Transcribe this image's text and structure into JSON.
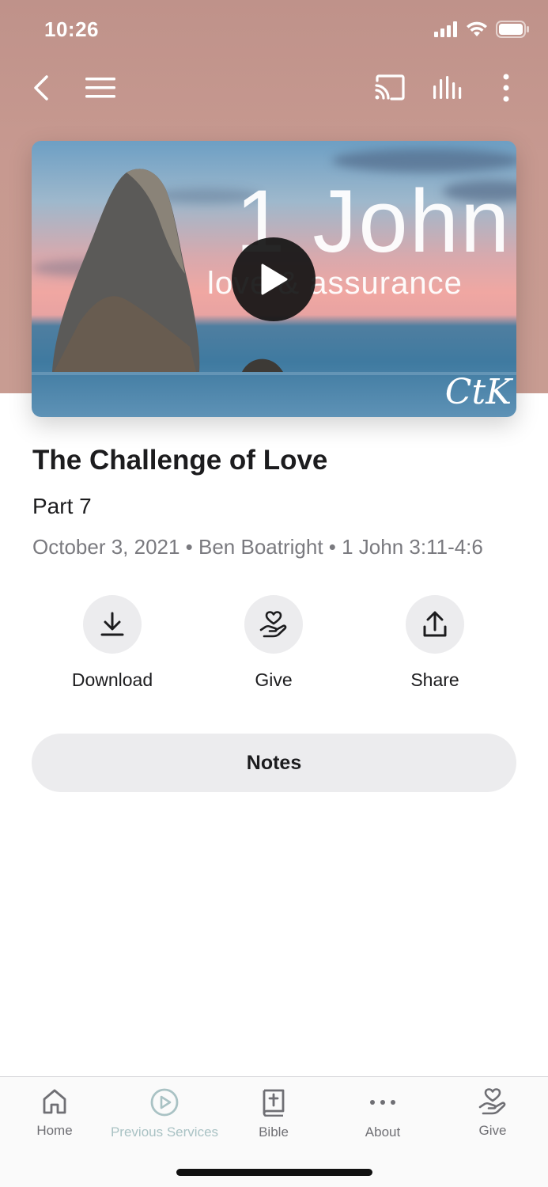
{
  "status_bar": {
    "time": "10:26"
  },
  "toolbar": {
    "back_icon": "chevron-left-icon",
    "menu_icon": "hamburger-icon",
    "cast_icon": "cast-icon",
    "audio_icon": "audio-bars-icon",
    "more_icon": "more-vertical-icon"
  },
  "hero": {
    "title": "1 John",
    "subtitle": "love & assurance",
    "logo": "CtK",
    "play_icon": "play-icon"
  },
  "sermon": {
    "title": "The Challenge of Love",
    "part": "Part 7",
    "meta": "October 3, 2021 • Ben Boatright • 1 John 3:11-4:6"
  },
  "actions": [
    {
      "label": "Download",
      "icon": "download-icon"
    },
    {
      "label": "Give",
      "icon": "hand-heart-icon"
    },
    {
      "label": "Share",
      "icon": "share-icon"
    }
  ],
  "notes_label": "Notes",
  "tabbar": {
    "items": [
      {
        "label": "Home",
        "icon": "home-icon"
      },
      {
        "label": "Previous Services",
        "icon": "play-circle-icon"
      },
      {
        "label": "Bible",
        "icon": "bible-icon"
      },
      {
        "label": "About",
        "icon": "ellipsis-icon"
      },
      {
        "label": "Give",
        "icon": "hand-heart-icon"
      }
    ]
  },
  "colors": {
    "header_bg": "#c49790",
    "button_bg": "#ececee",
    "meta_text": "#7a7a7f",
    "tab_inactive": "#6f6f74",
    "tab_dim": "#a9c2c4"
  }
}
